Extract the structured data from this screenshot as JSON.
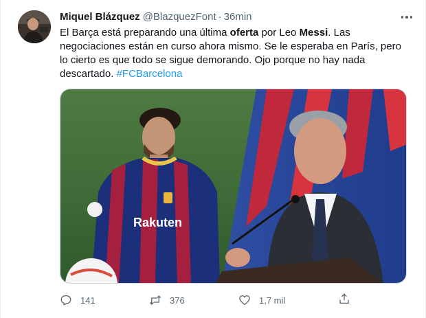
{
  "author": {
    "name": "Miquel Blázquez",
    "handle": "@BlazquezFont",
    "separator": "·",
    "time": "36min"
  },
  "tweet": {
    "segments": [
      {
        "text": "El Barça está preparando una última ",
        "style": "normal"
      },
      {
        "text": "oferta",
        "style": "bold"
      },
      {
        "text": " por Leo ",
        "style": "normal"
      },
      {
        "text": "Messi",
        "style": "bold"
      },
      {
        "text": ". Las negociaciones están en curso ahora mismo. Se le esperaba en París, pero lo cierto es que todo se sigue demorando. Ojo porque no hay nada descartado. ",
        "style": "normal"
      },
      {
        "text": "#FCBarcelona",
        "style": "hashtag"
      }
    ]
  },
  "media": {
    "jersey_sponsor": "Rakuten"
  },
  "actions": {
    "replies": "141",
    "retweets": "376",
    "likes": "1,7 mil"
  },
  "icons": {
    "more": "more-horizontal-icon",
    "reply": "reply-icon",
    "retweet": "retweet-icon",
    "like": "heart-icon",
    "share": "share-icon"
  },
  "colors": {
    "text": "#0f1419",
    "secondary": "#536471",
    "link": "#1d9bf0",
    "border": "#cfd9de"
  }
}
